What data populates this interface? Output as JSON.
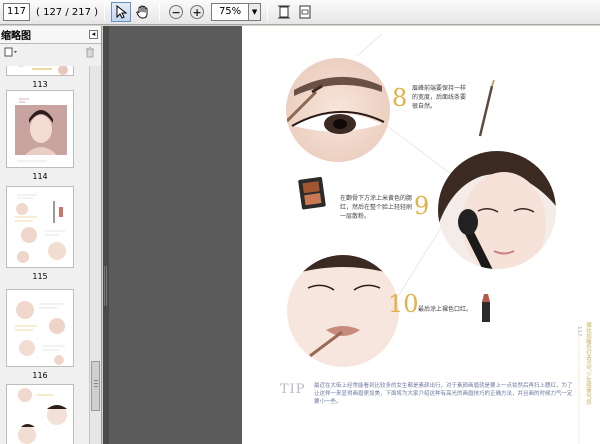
{
  "toolbar": {
    "page_value": "117",
    "page_count": "( 127 / 217 )",
    "zoom_value": "75%"
  },
  "panel": {
    "title": "缩略图",
    "thumbnails": [
      {
        "label": "113"
      },
      {
        "label": "114"
      },
      {
        "label": "115"
      },
      {
        "label": "116"
      }
    ]
  },
  "document": {
    "steps": [
      {
        "number": "8",
        "text": "眉峰前端要保持一样的宽度，后面线条要很自然。"
      },
      {
        "number": "9",
        "text": "在颧骨下方涂上米黄色的腮红，然后在整个脸上轻轻刷一层散粉。"
      },
      {
        "number": "10",
        "text": "最后涂上裸色口红。"
      }
    ],
    "tip": {
      "label": "TIP",
      "text": "最近在大街上经常能看到比较多的女生都是素颜出行，对于素颜画眉就是要上一点妆然后再扫上腮红，为了让这样一来显得画眉更加美，下面将为大家介绍这种有高光的画眉技巧的正确方法，并且画的时候力气一定要小一些。"
    },
    "side_caption": "裸妆加暖色打造元气少女甜美气息",
    "page_marker": "117"
  },
  "colors": {
    "accent_gold": "#e2b24a",
    "tip_blue": "#6e7aa2",
    "doc_background": "#5b5b5b"
  }
}
